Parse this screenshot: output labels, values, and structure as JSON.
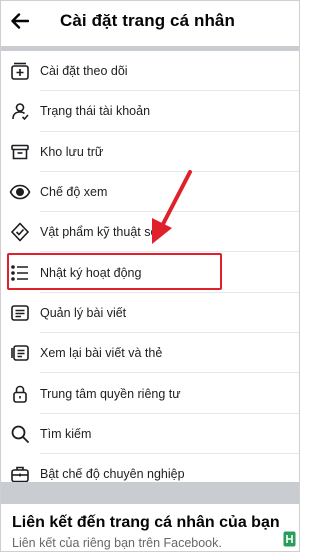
{
  "header": {
    "title": "Cài đặt trang cá nhân"
  },
  "menu": {
    "items": [
      {
        "label": "Cài đặt theo dõi",
        "icon": "follow-settings-icon"
      },
      {
        "label": "Trạng thái tài khoản",
        "icon": "account-status-icon"
      },
      {
        "label": "Kho lưu trữ",
        "icon": "archive-icon"
      },
      {
        "label": "Chế độ xem",
        "icon": "eye-icon"
      },
      {
        "label": "Vật phẩm kỹ thuật số",
        "icon": "badge-check-icon"
      },
      {
        "label": "Nhật ký hoạt động",
        "icon": "list-icon"
      },
      {
        "label": "Quản lý bài viết",
        "icon": "posts-icon"
      },
      {
        "label": "Xem lại bài viết và thẻ",
        "icon": "review-posts-icon"
      },
      {
        "label": "Trung tâm quyền riêng tư",
        "icon": "privacy-lock-icon"
      },
      {
        "label": "Tìm kiếm",
        "icon": "search-icon"
      },
      {
        "label": "Bật chế độ chuyên nghiệp",
        "icon": "briefcase-icon"
      }
    ],
    "highlighted_item": "Nhật ký hoạt động"
  },
  "section": {
    "title": "Liên kết đến trang cá nhân của bạn",
    "subtitle": "Liên kết của riêng bạn trên Facebook."
  },
  "colors": {
    "highlight": "#e0202b",
    "separator": "#c9ccd1"
  }
}
